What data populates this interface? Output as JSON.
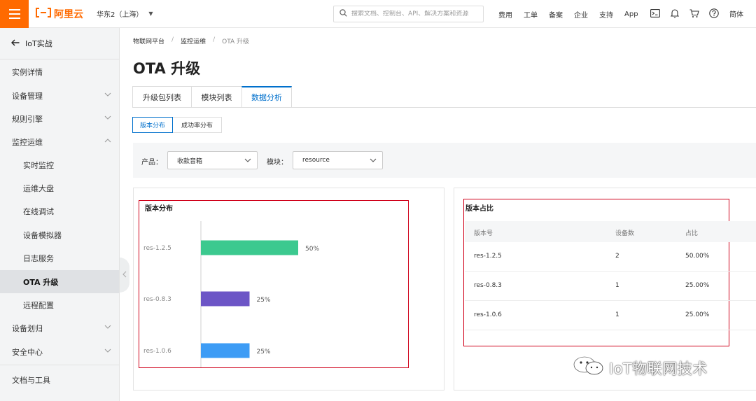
{
  "topbar": {
    "logo_text": "阿里云",
    "region": "华东2（上海）",
    "search_placeholder": "搜索文档、控制台、API、解决方案和资源",
    "links": [
      "费用",
      "工单",
      "备案",
      "企业",
      "支持",
      "App"
    ],
    "icons": [
      "terminal-icon",
      "bell-icon",
      "cart-icon",
      "help-icon"
    ],
    "language": "简体",
    "accent_color": "#ff6a00"
  },
  "sidebar": {
    "back_label": "IoT实战",
    "items": [
      {
        "label": "实例详情",
        "level": "top"
      },
      {
        "label": "设备管理",
        "level": "top",
        "expandable": true,
        "expanded": false
      },
      {
        "label": "规则引擎",
        "level": "top",
        "expandable": true,
        "expanded": false
      },
      {
        "label": "监控运维",
        "level": "top",
        "expandable": true,
        "expanded": true
      },
      {
        "label": "实时监控",
        "level": "sub"
      },
      {
        "label": "运维大盘",
        "level": "sub"
      },
      {
        "label": "在线调试",
        "level": "sub"
      },
      {
        "label": "设备模拟器",
        "level": "sub"
      },
      {
        "label": "日志服务",
        "level": "sub"
      },
      {
        "label": "OTA 升级",
        "level": "sub",
        "active": true
      },
      {
        "label": "远程配置",
        "level": "sub"
      },
      {
        "label": "设备划归",
        "level": "top",
        "expandable": true,
        "expanded": false
      },
      {
        "label": "安全中心",
        "level": "top",
        "expandable": true,
        "expanded": false
      }
    ],
    "footer_label": "文档与工具"
  },
  "breadcrumb": [
    "物联网平台",
    "监控运维",
    "OTA 升级"
  ],
  "page_title": "OTA 升级",
  "tabs": [
    {
      "label": "升级包列表",
      "active": false
    },
    {
      "label": "模块列表",
      "active": false
    },
    {
      "label": "数据分析",
      "active": true
    }
  ],
  "subtabs": [
    {
      "label": "版本分布",
      "active": true
    },
    {
      "label": "成功率分布",
      "active": false
    }
  ],
  "filters": {
    "product_label": "产品：",
    "product_value": "收款音箱",
    "module_label": "模块：",
    "module_value": "resource"
  },
  "distribution_panel": {
    "title": "版本分布"
  },
  "chart_data": {
    "type": "bar",
    "orientation": "horizontal",
    "title": "版本分布",
    "categories": [
      "res-1.2.5",
      "res-0.8.3",
      "res-1.0.6"
    ],
    "values": [
      50,
      25,
      25
    ],
    "value_labels": [
      "50%",
      "25%",
      "25%"
    ],
    "colors": [
      "#3cc98f",
      "#6c55c6",
      "#3d9cf5"
    ],
    "xlim": [
      0,
      100
    ],
    "grid": false,
    "legend": "none"
  },
  "ratio_panel": {
    "title": "版本占比",
    "columns": [
      "版本号",
      "设备数",
      "占比"
    ],
    "rows": [
      {
        "version": "res-1.2.5",
        "count": "2",
        "ratio": "50.00%"
      },
      {
        "version": "res-0.8.3",
        "count": "1",
        "ratio": "25.00%"
      },
      {
        "version": "res-1.0.6",
        "count": "1",
        "ratio": "25.00%"
      }
    ]
  },
  "watermark": {
    "text": "IoT物联网技术"
  }
}
